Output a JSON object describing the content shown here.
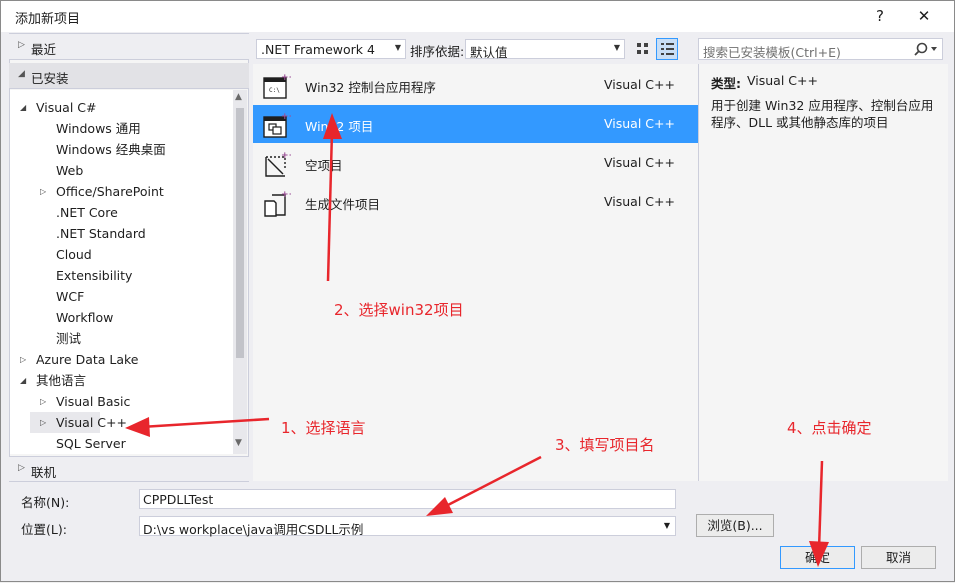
{
  "window": {
    "title": "添加新项目",
    "help_label": "?",
    "close_label": "✕"
  },
  "left": {
    "recent_label": "最近",
    "installed_label": "已安装",
    "online_label": "联机",
    "tree": [
      {
        "label": "Visual C#",
        "level": 0,
        "expander": "open"
      },
      {
        "label": "Windows 通用",
        "level": 1,
        "expander": "none"
      },
      {
        "label": "Windows 经典桌面",
        "level": 1,
        "expander": "none"
      },
      {
        "label": "Web",
        "level": 1,
        "expander": "none"
      },
      {
        "label": "Office/SharePoint",
        "level": 1,
        "expander": "closed"
      },
      {
        "label": ".NET Core",
        "level": 1,
        "expander": "none"
      },
      {
        "label": ".NET Standard",
        "level": 1,
        "expander": "none"
      },
      {
        "label": "Cloud",
        "level": 1,
        "expander": "none"
      },
      {
        "label": "Extensibility",
        "level": 1,
        "expander": "none"
      },
      {
        "label": "WCF",
        "level": 1,
        "expander": "none"
      },
      {
        "label": "Workflow",
        "level": 1,
        "expander": "none"
      },
      {
        "label": "测试",
        "level": 1,
        "expander": "none"
      },
      {
        "label": "Azure Data Lake",
        "level": 0,
        "expander": "closed"
      },
      {
        "label": "其他语言",
        "level": 0,
        "expander": "open"
      },
      {
        "label": "Visual Basic",
        "level": 1,
        "expander": "closed"
      },
      {
        "label": "Visual C++",
        "level": 1,
        "expander": "closed",
        "selected": true
      },
      {
        "label": "SQL Server",
        "level": 1,
        "expander": "none"
      }
    ]
  },
  "toolbar": {
    "framework": ".NET Framework 4",
    "sort_label": "排序依据:",
    "sort_value": "默认值",
    "search_placeholder": "搜索已安装模板(Ctrl+E)"
  },
  "templates": [
    {
      "name": "Win32 控制台应用程序",
      "lang": "Visual C++",
      "icon": "console-app-icon",
      "selected": false
    },
    {
      "name": "Win32 项目",
      "lang": "Visual C++",
      "icon": "win32-project-icon",
      "selected": true
    },
    {
      "name": "空项目",
      "lang": "Visual C++",
      "icon": "empty-project-icon",
      "selected": false
    },
    {
      "name": "生成文件项目",
      "lang": "Visual C++",
      "icon": "makefile-project-icon",
      "selected": false
    }
  ],
  "details": {
    "type_label": "类型:",
    "type_value": "Visual C++",
    "description": "用于创建 Win32 应用程序、控制台应用程序、DLL 或其他静态库的项目"
  },
  "form": {
    "name_label": "名称(N):",
    "name_value": "CPPDLLTest",
    "location_label": "位置(L):",
    "location_value": "D:\\vs workplace\\java调用CSDLL示例",
    "browse_label": "浏览(B)...",
    "ok_label": "确定",
    "cancel_label": "取消"
  },
  "annotations": {
    "step1": "1、选择语言",
    "step2": "2、选择win32项目",
    "step3": "3、填写项目名",
    "step4": "4、点击确定"
  },
  "colors": {
    "selection": "#3399ff",
    "annotation": "#e8262c",
    "accent": "#9b4f96"
  }
}
